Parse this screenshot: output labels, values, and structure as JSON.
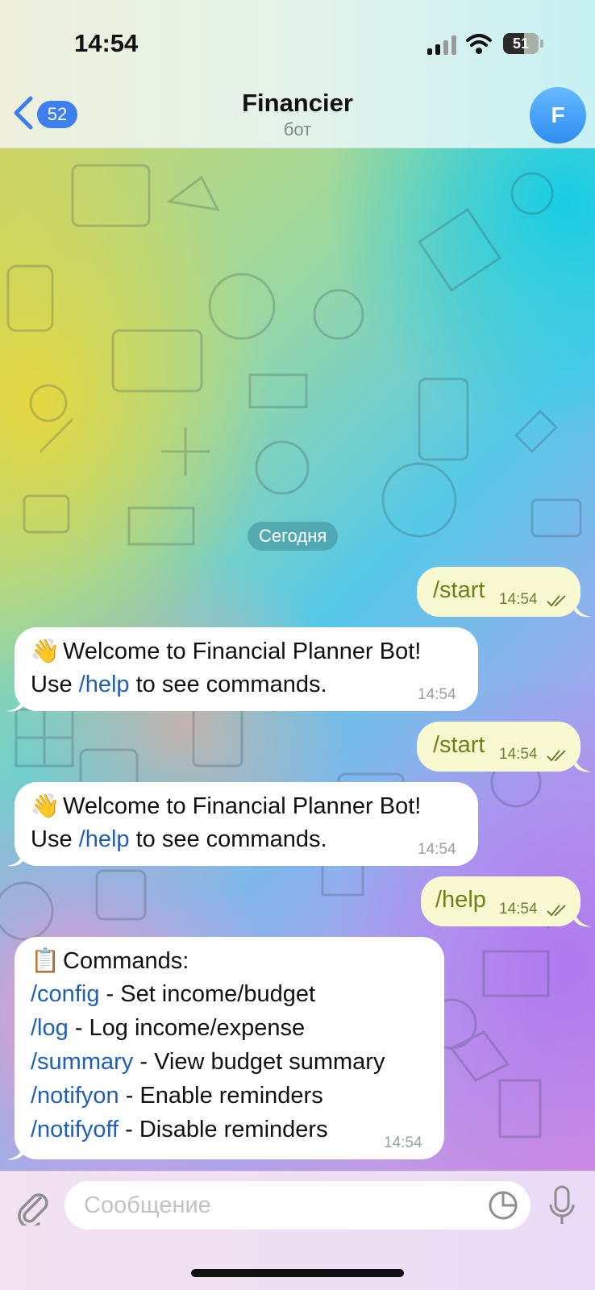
{
  "status_bar": {
    "time": "14:54",
    "battery": "51"
  },
  "header": {
    "back_count": "52",
    "title": "Financier",
    "subtitle": "бот",
    "avatar_letter": "F"
  },
  "date_separator": "Сегодня",
  "messages": [
    {
      "dir": "out",
      "text": "/start",
      "time": "14:54"
    },
    {
      "dir": "in",
      "emoji": "👋",
      "line1": "Welcome to Financial Planner Bot!",
      "line2_pre": "Use ",
      "line2_cmd": "/help",
      "line2_post": " to see commands.",
      "time": "14:54"
    },
    {
      "dir": "out",
      "text": "/start",
      "time": "14:54"
    },
    {
      "dir": "in",
      "emoji": "👋",
      "line1": "Welcome to Financial Planner Bot!",
      "line2_pre": "Use ",
      "line2_cmd": "/help",
      "line2_post": " to see commands.",
      "time": "14:54"
    },
    {
      "dir": "out",
      "text": "/help",
      "time": "14:54"
    },
    {
      "dir": "in",
      "emoji": "📋",
      "heading": "Commands:",
      "commands": [
        {
          "cmd": "/config",
          "desc": " - Set income/budget"
        },
        {
          "cmd": "/log",
          "desc": " - Log income/expense"
        },
        {
          "cmd": "/summary",
          "desc": " - View budget summary"
        },
        {
          "cmd": "/notifyon",
          "desc": " - Enable reminders"
        },
        {
          "cmd": "/notifyoff",
          "desc": " - Disable reminders"
        }
      ],
      "time": "14:54"
    }
  ],
  "composer": {
    "placeholder": "Сообщение"
  },
  "colors": {
    "accent": "#3d7ff0",
    "outgoing_bubble": "#f9f9d1",
    "command_link": "#1f5fb6"
  }
}
